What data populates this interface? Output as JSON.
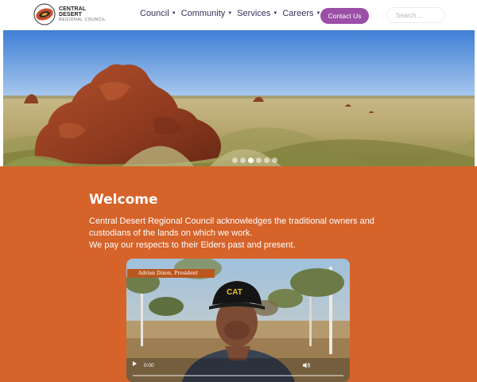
{
  "header": {
    "logo_line1": "CENTRAL DESERT",
    "logo_line2": "REGIONAL COUNCIL",
    "nav": [
      {
        "label": "Council"
      },
      {
        "label": "Community"
      },
      {
        "label": "Services"
      },
      {
        "label": "Careers"
      }
    ],
    "contact_label": "Contact Us",
    "search_placeholder": "Search ..."
  },
  "hero": {
    "slide_count": 6,
    "active_slide": 3
  },
  "welcome": {
    "title": "Welcome",
    "lines": [
      "Central Desert Regional Council acknowledges the traditional owners and",
      "custodians of the lands on which we work.",
      "We pay our respects to their Elders past and present."
    ]
  },
  "video": {
    "caption": "Adrian Dixon, President",
    "time": "0:00",
    "cap_text": "CAT"
  },
  "colors": {
    "brand_purple": "#9b4fa6",
    "orange_section": "#d6632a",
    "nav_text": "#3a2e5c"
  },
  "icons": [
    "logo-emblem-icon",
    "chevron-down-icon",
    "play-icon",
    "volume-icon"
  ]
}
